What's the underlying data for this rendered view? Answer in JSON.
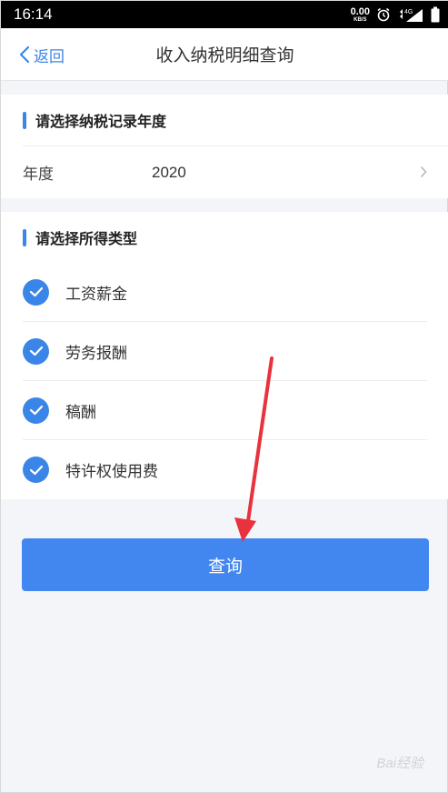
{
  "status_bar": {
    "time": "16:14",
    "net_speed": "0.00",
    "net_unit": "KB/S",
    "network": "4G"
  },
  "nav": {
    "back_label": "返回",
    "title": "收入纳税明细查询"
  },
  "year_section": {
    "heading": "请选择纳税记录年度",
    "field_label": "年度",
    "field_value": "2020"
  },
  "type_section": {
    "heading": "请选择所得类型",
    "options": [
      {
        "label": "工资薪金",
        "checked": true
      },
      {
        "label": "劳务报酬",
        "checked": true
      },
      {
        "label": "稿酬",
        "checked": true
      },
      {
        "label": "特许权使用费",
        "checked": true
      }
    ]
  },
  "query_button": {
    "label": "查询"
  },
  "watermark": "Bai经验",
  "colors": {
    "accent": "#3a86e8",
    "button": "#4287f0",
    "annotation_arrow": "#e8323c"
  }
}
